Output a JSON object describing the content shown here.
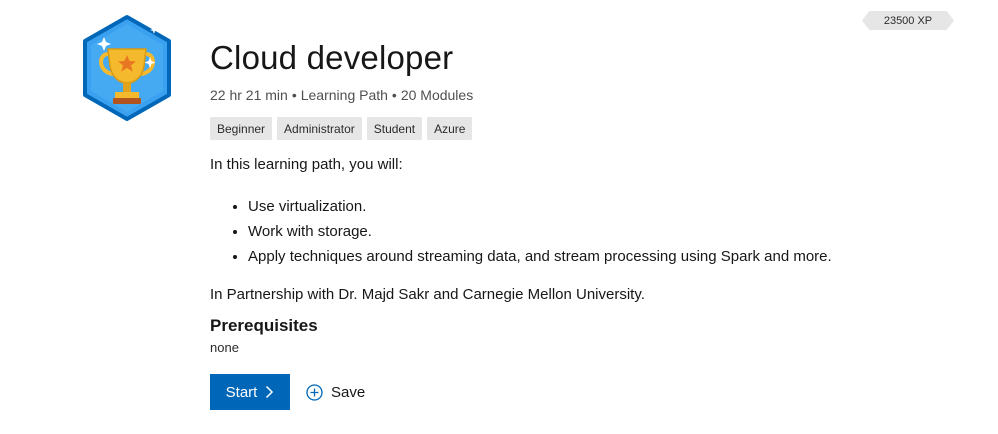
{
  "xp": {
    "label": "23500 XP"
  },
  "badge": {
    "icon": "trophy-hexagon-icon",
    "colors": {
      "hex_fill": "#3aa0f0",
      "hex_border": "#0067b8",
      "trophy": "#f5b92e",
      "star": "#e87722"
    }
  },
  "header": {
    "title": "Cloud developer",
    "duration": "22 hr 21 min",
    "type": "Learning Path",
    "modules": "20 Modules",
    "separator": "•"
  },
  "tags": [
    "Beginner",
    "Administrator",
    "Student",
    "Azure"
  ],
  "description": {
    "intro": "In this learning path, you will:",
    "bullets": [
      "Use virtualization.",
      "Work with storage.",
      "Apply techniques around streaming data, and stream processing using Spark and more."
    ],
    "partnership": "In Partnership with Dr. Majd Sakr and Carnegie Mellon University."
  },
  "prerequisites": {
    "title": "Prerequisites",
    "value": "none"
  },
  "actions": {
    "start_label": "Start",
    "save_label": "Save",
    "start_icon": "chevron-right-icon",
    "save_icon": "plus-circle-icon",
    "accent": "#0067b8"
  }
}
